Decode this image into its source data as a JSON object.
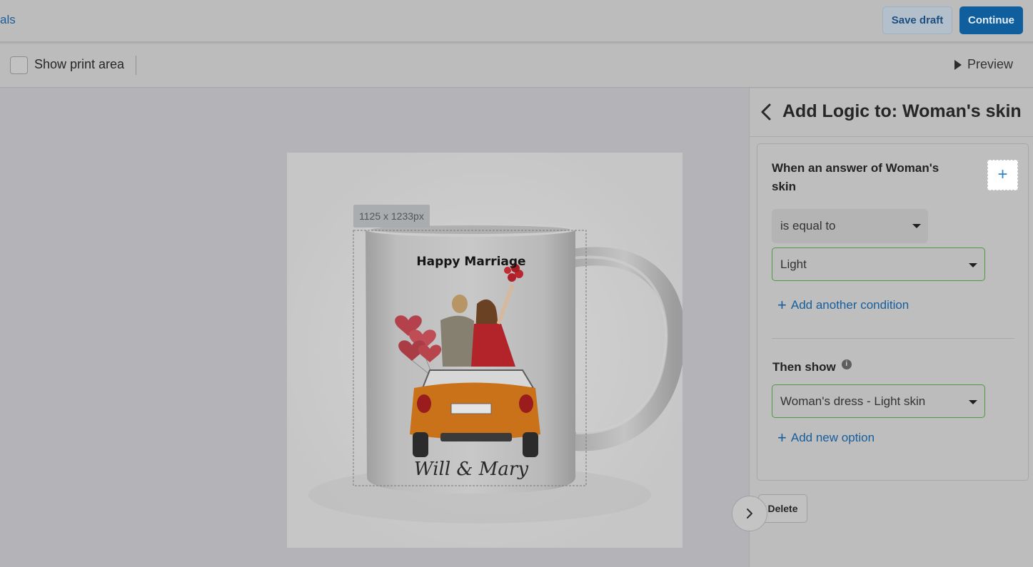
{
  "topbar": {
    "back_label": "als",
    "save_draft": "Save draft",
    "continue": "Continue"
  },
  "toolbar": {
    "show_print_area": "Show print area",
    "preview": "Preview"
  },
  "canvas": {
    "size_label": "1125 x 1233px",
    "mug_headline": "Happy Marriage",
    "mug_names": "Will & Mary"
  },
  "panel": {
    "title": "Add Logic to: Woman's skin",
    "condition_title": "When an answer of Woman's skin",
    "operator": "is equal to",
    "value": "Light",
    "add_condition": "Add another condition",
    "then_show": "Then show",
    "show_option": "Woman's dress - Light skin",
    "add_option": "Add new option",
    "delete": "Delete"
  },
  "icons": {
    "back": "chevron-left-icon",
    "play": "play-icon",
    "plus": "plus-icon",
    "info": "info-icon",
    "expand": "chevron-right-icon",
    "caret": "caret-down-icon"
  },
  "colors": {
    "primary": "#0f5f9e",
    "link": "#165e9c",
    "valid_border": "#4d9b3d",
    "add_button": "#2e86c8"
  }
}
